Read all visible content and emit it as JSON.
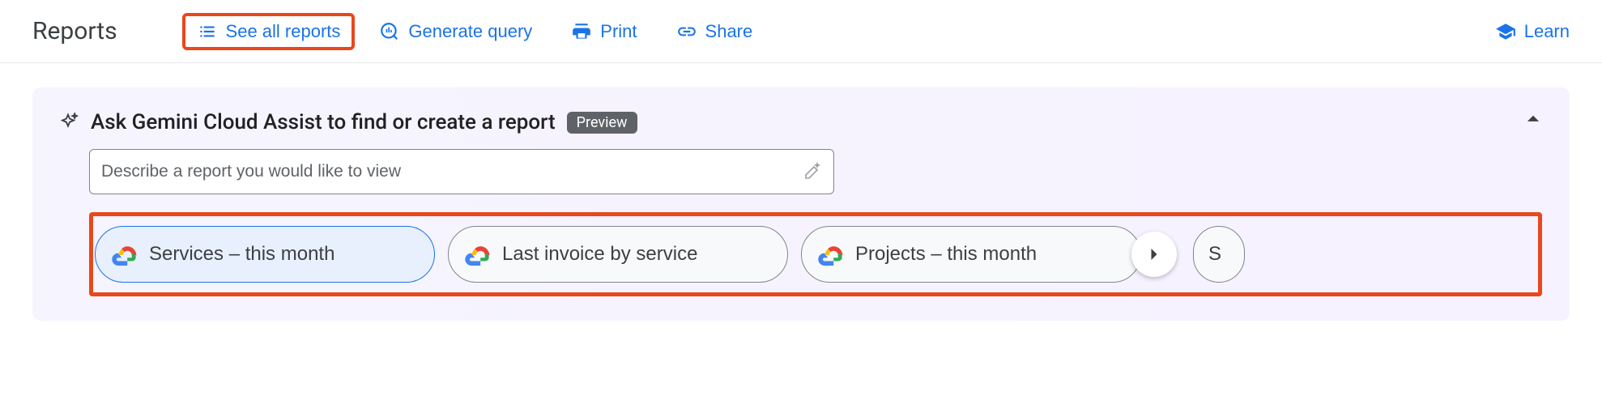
{
  "header": {
    "title": "Reports",
    "actions": {
      "see_all": "See all reports",
      "generate": "Generate query",
      "print": "Print",
      "share": "Share",
      "learn": "Learn"
    }
  },
  "panel": {
    "title": "Ask Gemini Cloud Assist to find or create a report",
    "badge": "Preview",
    "input_placeholder": "Describe a report you would like to view",
    "chips": [
      {
        "label": "Services – this month",
        "selected": true
      },
      {
        "label": "Last invoice by service",
        "selected": false
      },
      {
        "label": "Projects – this month",
        "selected": false
      }
    ],
    "overflow_hint": "S"
  }
}
